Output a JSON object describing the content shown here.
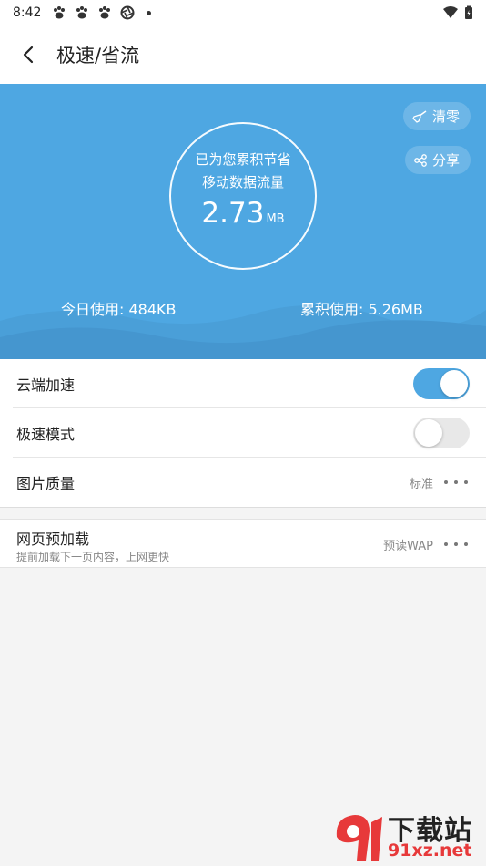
{
  "status_bar": {
    "time": "8:42"
  },
  "app_bar": {
    "title": "极速/省流"
  },
  "hero": {
    "clear_label": "清零",
    "share_label": "分享",
    "saved_line1": "已为您累积节省",
    "saved_line2": "移动数据流量",
    "saved_value": "2.73",
    "saved_unit": "MB",
    "today_usage": "今日使用: 484KB",
    "total_usage": "累积使用: 5.26MB",
    "bg_color": "#4ea7e2"
  },
  "settings": {
    "cloud_accel": {
      "label": "云端加速",
      "enabled": true
    },
    "speed_mode": {
      "label": "极速模式",
      "enabled": false
    },
    "image_quality": {
      "label": "图片质量",
      "value": "标准"
    }
  },
  "preload": {
    "title": "网页预加载",
    "subtitle": "提前加载下一页内容，上网更快",
    "value": "预读WAP"
  },
  "watermark": {
    "brand": "下载站",
    "site": "91xz.net"
  }
}
